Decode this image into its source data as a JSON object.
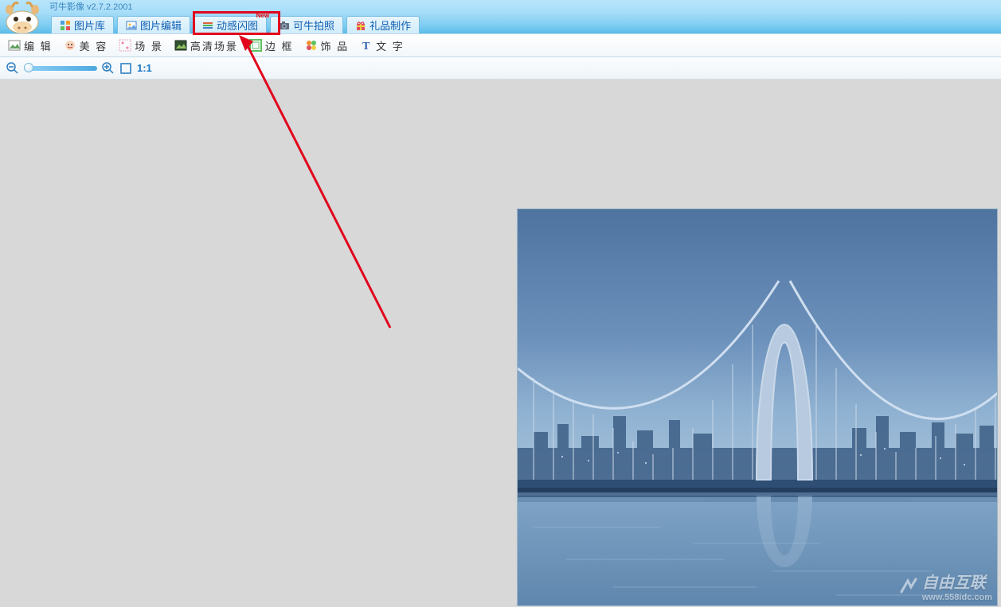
{
  "app": {
    "title": "可牛影像 v2.7.2.2001"
  },
  "main_tabs": {
    "library": "图片库",
    "edit": "图片编辑",
    "animated": "动感闪图",
    "camera": "可牛拍照",
    "gift": "礼品制作"
  },
  "sub_tools": {
    "edit": "编 辑",
    "beauty": "美 容",
    "scene": "场 景",
    "hd_scene": "高清场景",
    "frame": "边 框",
    "decor": "饰 品",
    "text": "文 字"
  },
  "zoom": {
    "ratio": "1:1"
  },
  "watermark": {
    "brand": "自由互联",
    "url": "www.558idc.com"
  }
}
